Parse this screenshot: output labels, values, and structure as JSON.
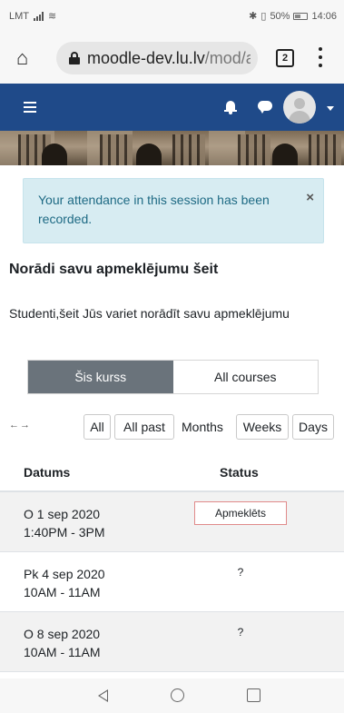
{
  "status_bar": {
    "carrier": "LMT",
    "battery": "50%",
    "time": "14:06"
  },
  "browser": {
    "url_host": "moodle-dev.lu.lv",
    "url_path": "/mod/a",
    "tab_count": "2"
  },
  "alert": {
    "text": "Your attendance in this session has been recorded.",
    "close": "×"
  },
  "page": {
    "title": "Norādi savu apmeklējumu šeit",
    "description": "Studenti,šeit Jūs variet norādīt savu apmeklējumu"
  },
  "scope_tabs": [
    {
      "label": "Šis kurss",
      "active": true
    },
    {
      "label": "All courses",
      "active": false
    }
  ],
  "view_controls": {
    "arrows": "←→",
    "buttons": [
      "All",
      "All past",
      "Months",
      "Weeks",
      "Days"
    ]
  },
  "table": {
    "headers": [
      "Datums",
      "Status"
    ],
    "rows": [
      {
        "date": "O 1 sep 2020",
        "time": "1:40PM - 3PM",
        "status": "Apmeklēts"
      },
      {
        "date": "Pk 4 sep 2020",
        "time": "10AM - 11AM",
        "status": "?"
      },
      {
        "date": "O 8 sep 2020",
        "time": "10AM - 11AM",
        "status": "?"
      }
    ]
  },
  "colors": {
    "navbar": "#1f4a89",
    "alert_bg": "#d7ecf2",
    "alert_text": "#1e6a84",
    "active_tab": "#6a737b",
    "status_border": "#e08a8a"
  }
}
